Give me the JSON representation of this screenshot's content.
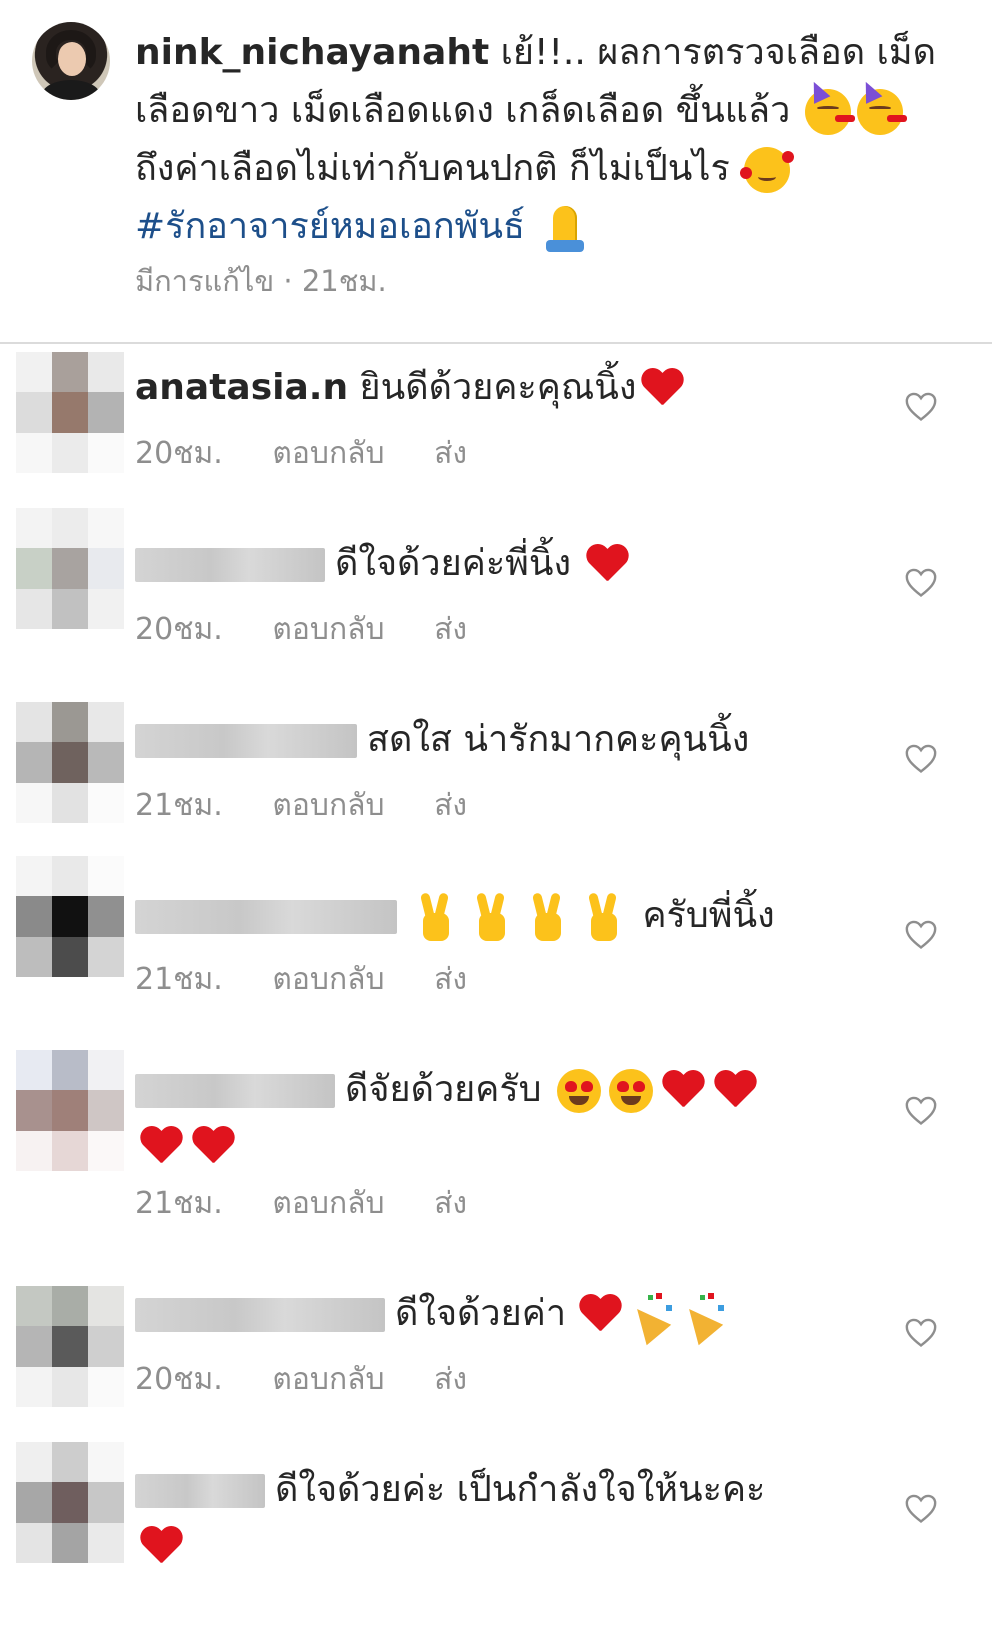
{
  "caption": {
    "username": "nink_nichayanaht",
    "text_part1": " เย้!!.. ผลการตรวจเลือด เม็ดเลือดขาว เม็ดเลือดแดง เกล็ดเลือด ขึ้นแล้ว ",
    "text_part2": " ถึงค่าเลือดไม่เท่ากับคนปกติ ก็ไม่เป็นไร ",
    "hashtag": "#รักอาจารย์หมอเอกพันธ์",
    "meta": "มีการแก้ไข · 21ชม.",
    "emojis": [
      "partying-face",
      "partying-face",
      "smiling-face-with-hearts",
      "folded-hands"
    ]
  },
  "comments": [
    {
      "username": "anatasia.n",
      "text": "ยินดีด้วยคะคุณนิ้ง",
      "time": "20ชม.",
      "reply": "ตอบกลับ",
      "send": "ส่ง",
      "emojis": [
        "red-heart"
      ]
    },
    {
      "username": "",
      "text": "ดีใจด้วยค่ะพี่นิ้ง",
      "time": "20ชม.",
      "reply": "ตอบกลับ",
      "send": "ส่ง",
      "emojis": [
        "red-heart"
      ]
    },
    {
      "username": "",
      "text": "สดใส น่ารักมากคะคุนนิ้ง",
      "time": "21ชม.",
      "reply": "ตอบกลับ",
      "send": "ส่ง",
      "emojis": []
    },
    {
      "username": "",
      "text": "ครับพี่นิ้ง",
      "time": "21ชม.",
      "reply": "ตอบกลับ",
      "send": "ส่ง",
      "emojis": [
        "victory-hand",
        "victory-hand",
        "victory-hand",
        "victory-hand"
      ]
    },
    {
      "username": "",
      "text": "ดีจัยด้วยครับ",
      "time": "21ชม.",
      "reply": "ตอบกลับ",
      "send": "ส่ง",
      "emojis": [
        "heart-eyes",
        "heart-eyes",
        "red-heart",
        "red-heart",
        "red-heart",
        "red-heart"
      ]
    },
    {
      "username": "",
      "text": "ดีใจด้วยค่า",
      "time": "20ชม.",
      "reply": "ตอบกลับ",
      "send": "ส่ง",
      "emojis": [
        "red-heart",
        "party-popper",
        "party-popper"
      ]
    },
    {
      "username": "",
      "text": "ดีใจด้วยค่ะ เป็นกำลังใจให้นะคะ",
      "time": "",
      "reply": "",
      "send": "",
      "emojis": [
        "red-heart"
      ]
    }
  ],
  "colors": {
    "hashtag": "#1d4f8a",
    "meta": "#8e8e8e",
    "heart": "#e0141e",
    "text": "#262626"
  },
  "icons": {
    "like": "heart-outline-icon"
  }
}
